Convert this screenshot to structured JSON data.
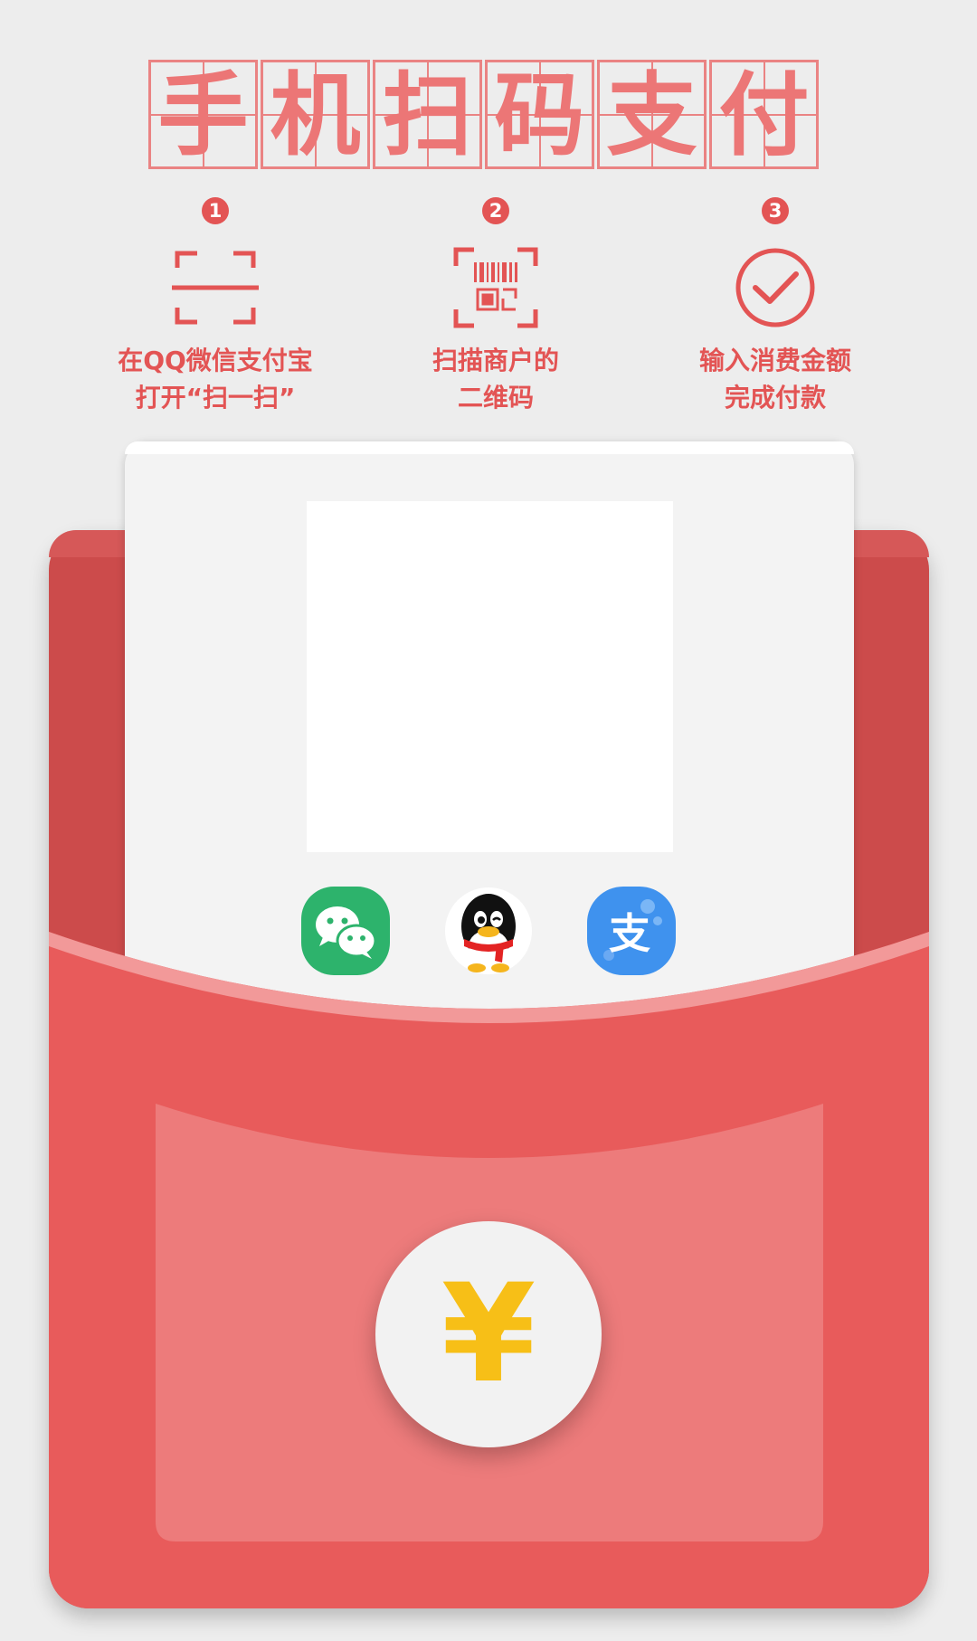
{
  "title": {
    "chars": [
      "手",
      "机",
      "扫",
      "码",
      "支",
      "付"
    ]
  },
  "steps": [
    {
      "number": "1",
      "icon": "scan-frame-icon",
      "line1": "在QQ微信支付宝",
      "line2": "打开“扫一扫”"
    },
    {
      "number": "2",
      "icon": "barcode-scan-icon",
      "line1": "扫描商户的",
      "line2": "二维码"
    },
    {
      "number": "3",
      "icon": "checkmark-circle-icon",
      "line1": "输入消费金额",
      "line2": "完成付款"
    }
  ],
  "card": {
    "payment_apps": [
      "wechat-icon",
      "qq-icon",
      "alipay-icon"
    ],
    "alipay_glyph": "支"
  },
  "coin": {
    "symbol": "¥"
  },
  "colors": {
    "accent": "#e35454",
    "envelope": "#e85b5b",
    "envelope_dark": "#cc4b4b",
    "pocket": "#ed7b7b",
    "coin_symbol": "#f7bf17",
    "wechat": "#2db36c",
    "alipay": "#3f92ee"
  }
}
